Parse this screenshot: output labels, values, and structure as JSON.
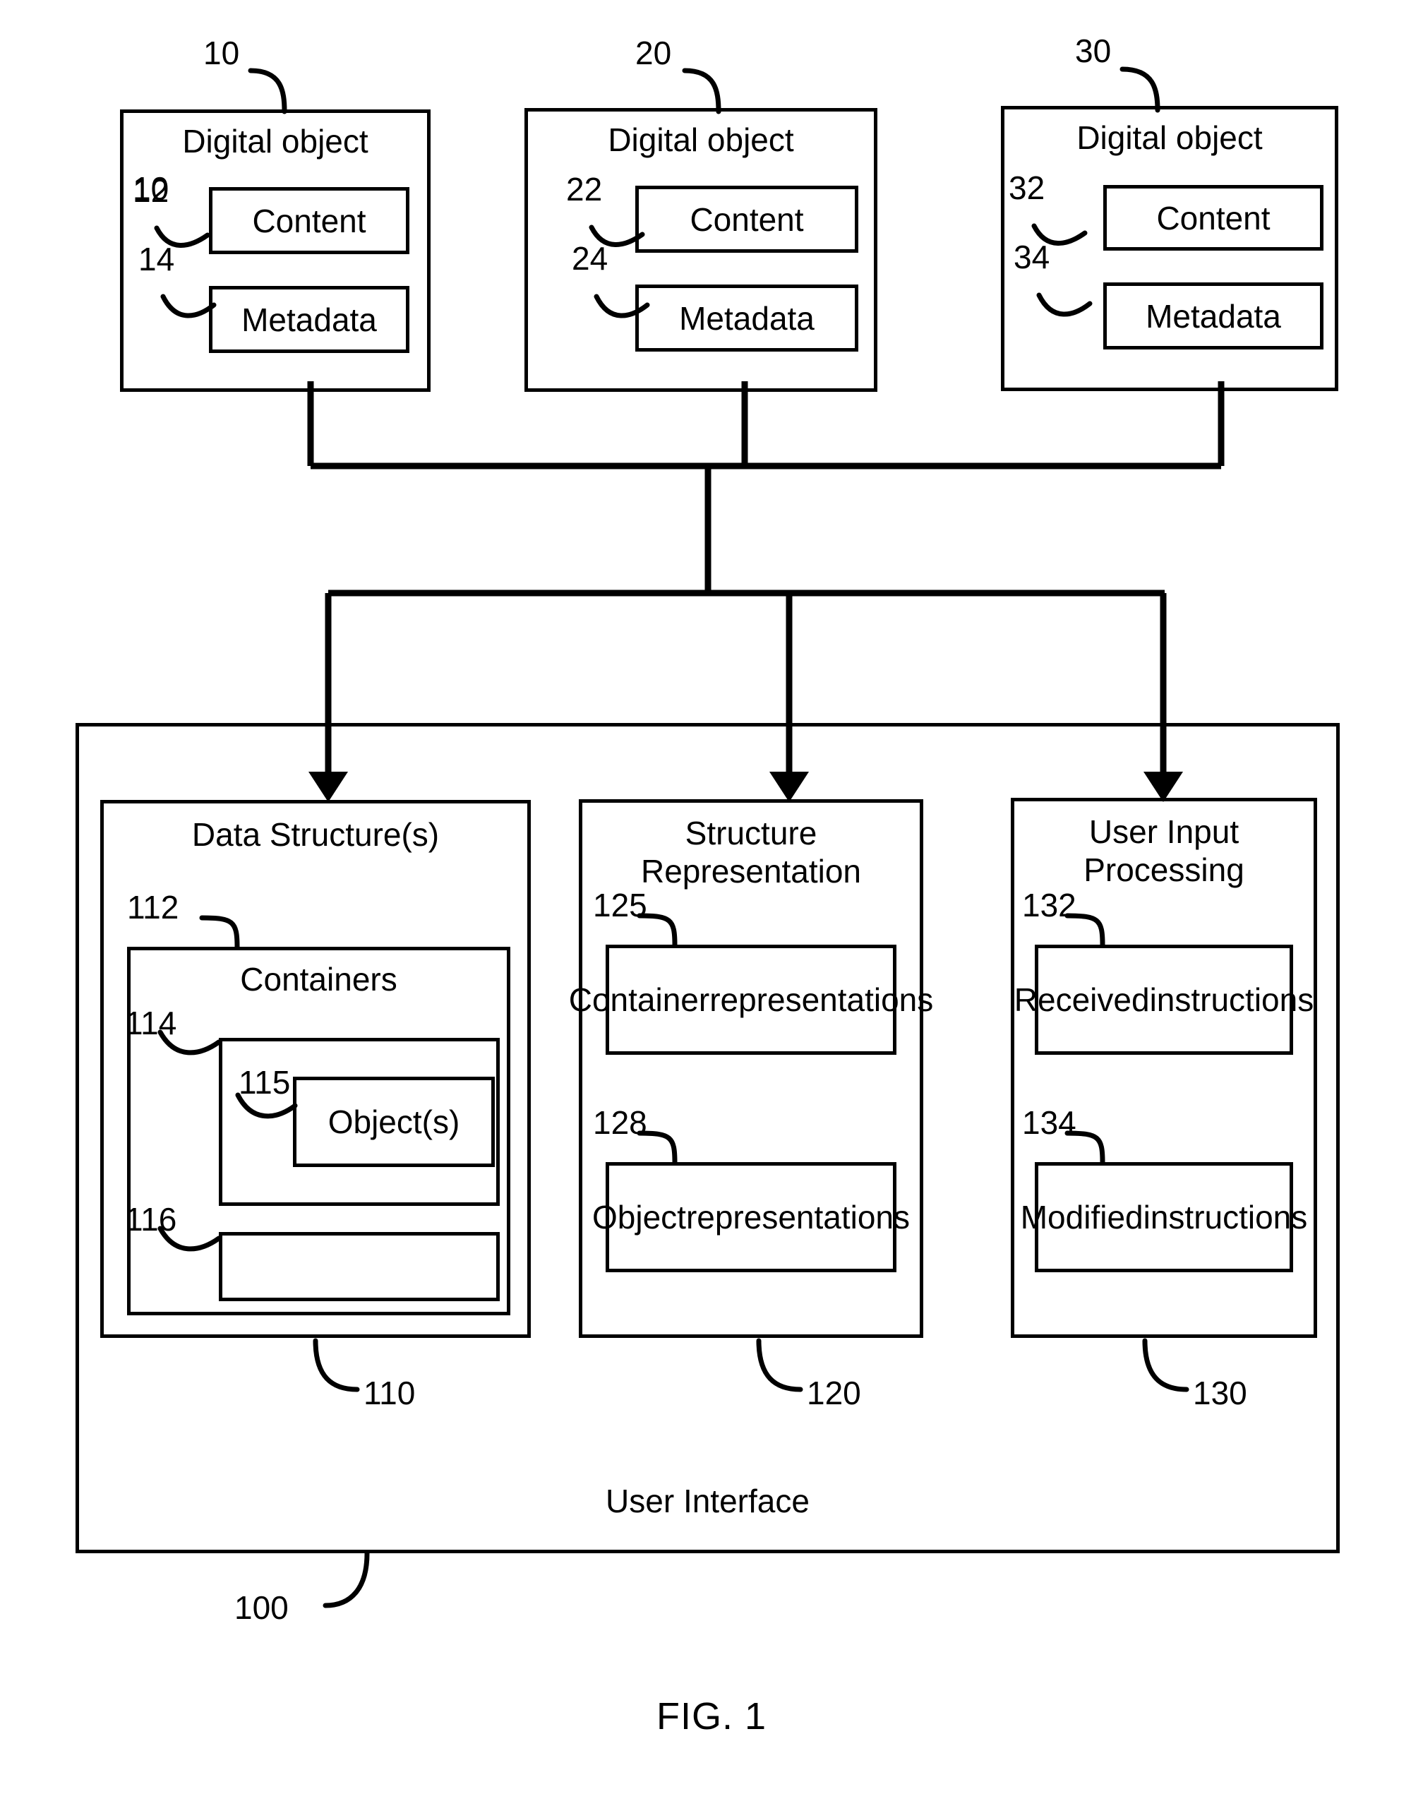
{
  "figure": {
    "caption": "FIG. 1"
  },
  "digital_objects": [
    {
      "ref": "10",
      "title": "Digital object",
      "content": {
        "ref": "12",
        "label": "Content"
      },
      "metadata": {
        "ref": "14",
        "label": "Metadata"
      }
    },
    {
      "ref": "20",
      "title": "Digital object",
      "content": {
        "ref": "22",
        "label": "Content"
      },
      "metadata": {
        "ref": "24",
        "label": "Metadata"
      }
    },
    {
      "ref": "30",
      "title": "Digital object",
      "content": {
        "ref": "32",
        "label": "Content"
      },
      "metadata": {
        "ref": "34",
        "label": "Metadata"
      }
    }
  ],
  "user_interface": {
    "ref": "100",
    "label": "User Interface",
    "panels": [
      {
        "ref": "110",
        "title": "Data Structure(s)",
        "containers": {
          "ref": "112",
          "title": "Containers",
          "items": [
            {
              "ref": "114",
              "label": "",
              "inner": {
                "ref": "115",
                "label": "Object(s)"
              }
            },
            {
              "ref": "116",
              "label": ""
            }
          ]
        }
      },
      {
        "ref": "120",
        "title": "Structure\nRepresentation",
        "items": [
          {
            "ref": "125",
            "label": "Container\nrepresentations"
          },
          {
            "ref": "128",
            "label": "Object\nrepresentations"
          }
        ]
      },
      {
        "ref": "130",
        "title": "User Input\nProcessing",
        "items": [
          {
            "ref": "132",
            "label": "Received\ninstructions"
          },
          {
            "ref": "134",
            "label": "Modified\ninstructions"
          }
        ]
      }
    ]
  }
}
